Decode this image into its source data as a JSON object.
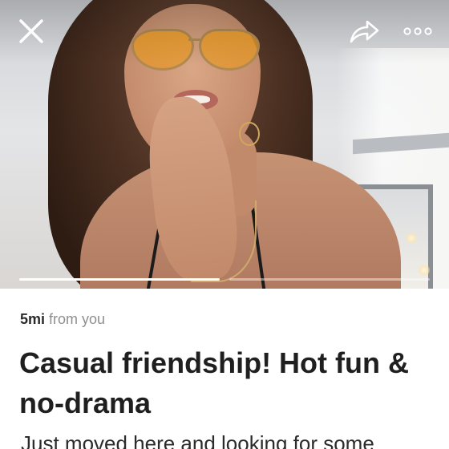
{
  "header": {
    "close_icon": "close-icon",
    "share_icon": "share-icon",
    "more_icon": "more-options-icon"
  },
  "photo": {
    "pages": 2,
    "active_page": 1
  },
  "listing": {
    "distance_value": "5mi",
    "distance_suffix": "from you",
    "title": "Casual friendship! Hot fun & no-drama",
    "description": "Just moved here and looking for some"
  }
}
